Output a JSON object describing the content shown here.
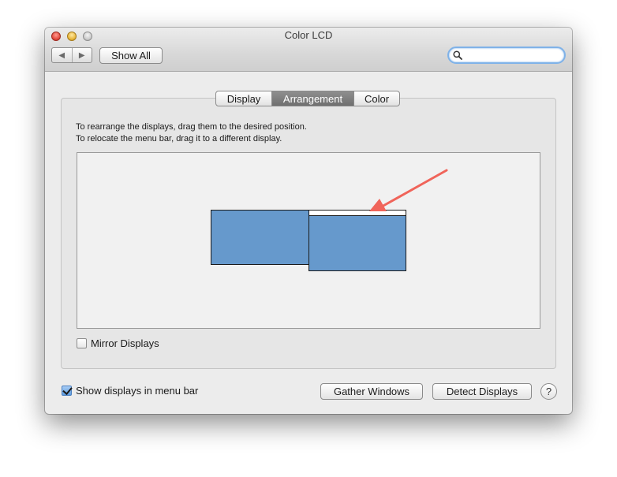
{
  "window": {
    "title": "Color LCD"
  },
  "toolbar": {
    "back_glyph": "◀",
    "forward_glyph": "▶",
    "show_all_label": "Show All",
    "search_value": "",
    "search_placeholder": ""
  },
  "tabs": [
    {
      "label": "Display",
      "selected": false
    },
    {
      "label": "Arrangement",
      "selected": true
    },
    {
      "label": "Color",
      "selected": false
    }
  ],
  "arrangement": {
    "instruction_line1": "To rearrange the displays, drag them to the desired position.",
    "instruction_line2": "To relocate the menu bar, drag it to a different display.",
    "display_color": "#6699cc",
    "annotation_arrow_color": "#f0645a"
  },
  "mirror_displays": {
    "label": "Mirror Displays",
    "checked": false
  },
  "footer": {
    "show_in_menubar_label": "Show displays in menu bar",
    "show_in_menubar_checked": true,
    "gather_windows_label": "Gather Windows",
    "detect_displays_label": "Detect Displays",
    "help_glyph": "?"
  }
}
